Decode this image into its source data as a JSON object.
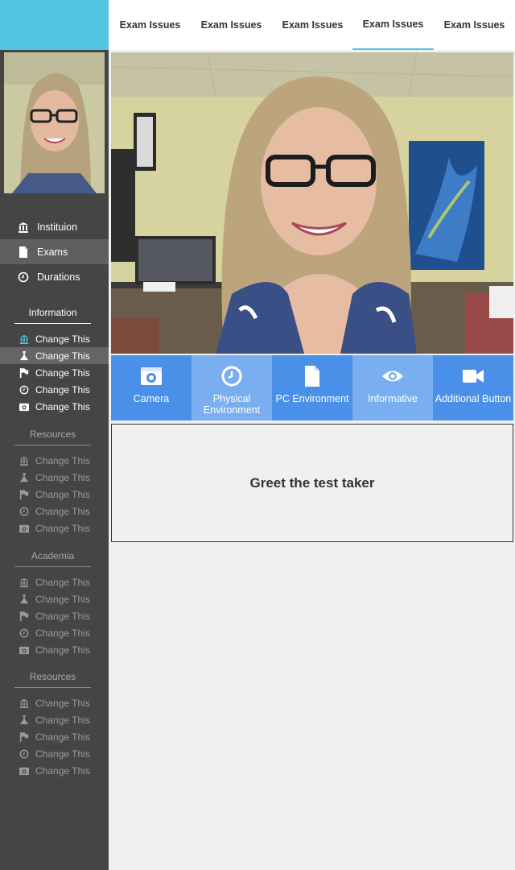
{
  "sidebar": {
    "nav": [
      {
        "label": "Instituion",
        "icon": "bank-icon"
      },
      {
        "label": "Exams",
        "icon": "document-icon"
      },
      {
        "label": "Durations",
        "icon": "clock-icon"
      }
    ],
    "sections": [
      {
        "title": "Information",
        "items": [
          "Change This",
          "Change This",
          "Change This",
          "Change This",
          "Change This"
        ]
      },
      {
        "title": "Resources",
        "items": [
          "Change This",
          "Change This",
          "Change This",
          "Change This",
          "Change This"
        ]
      },
      {
        "title": "Academia",
        "items": [
          "Change This",
          "Change This",
          "Change This",
          "Change This",
          "Change This"
        ]
      },
      {
        "title": "Resources",
        "items": [
          "Change This",
          "Change This",
          "Change This",
          "Change This",
          "Change This"
        ]
      }
    ],
    "item_icons": [
      "bank-icon",
      "flask-icon",
      "flag-icon",
      "clock-icon",
      "camera-icon"
    ]
  },
  "tabs": [
    "Exam Issues",
    "Exam Issues",
    "Exam Issues",
    "Exam Issues",
    "Exam Issues"
  ],
  "actions": [
    {
      "label": "Camera",
      "icon": "camera-icon"
    },
    {
      "label": "Physical Environment",
      "icon": "clock-icon"
    },
    {
      "label": "PC Environment",
      "icon": "document-icon"
    },
    {
      "label": "Informative",
      "icon": "eye-icon"
    },
    {
      "label": "Additional Button",
      "icon": "video-camera-icon"
    }
  ],
  "panel": {
    "text": "Greet the test taker"
  },
  "colors": {
    "accent": "#52c5e1",
    "action_bar": "#4a90e8",
    "action_alt": "#79aff0",
    "sidebar": "#454545"
  }
}
